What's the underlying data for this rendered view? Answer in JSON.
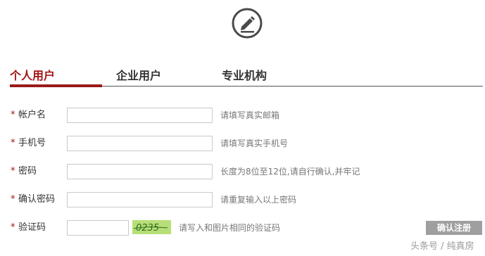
{
  "top_icon": {
    "name": "edit-pencil-icon"
  },
  "tabs": [
    {
      "label": "个人用户",
      "active": true
    },
    {
      "label": "企业用户",
      "active": false
    },
    {
      "label": "专业机构",
      "active": false
    }
  ],
  "form": {
    "required_mark": "*",
    "rows": [
      {
        "label": "帐户名",
        "value": "",
        "hint": "请填写真实邮箱"
      },
      {
        "label": "手机号",
        "value": "",
        "hint": "请填写真实手机号"
      },
      {
        "label": "密码",
        "value": "",
        "hint": "长度为8位至12位,请自行确认,并牢记"
      },
      {
        "label": "确认密码",
        "value": "",
        "hint": "请重复输入以上密码"
      },
      {
        "label": "验证码",
        "value": "",
        "hint": "请写入和图片相同的验证码"
      }
    ],
    "captcha_text": "0235",
    "submit_label": "确认注册"
  },
  "colors": {
    "accent": "#9a1b1b",
    "captcha_bg": "#b7df77",
    "button_bg": "#9f9f9f"
  },
  "watermark": "头条号 / 纯真房"
}
